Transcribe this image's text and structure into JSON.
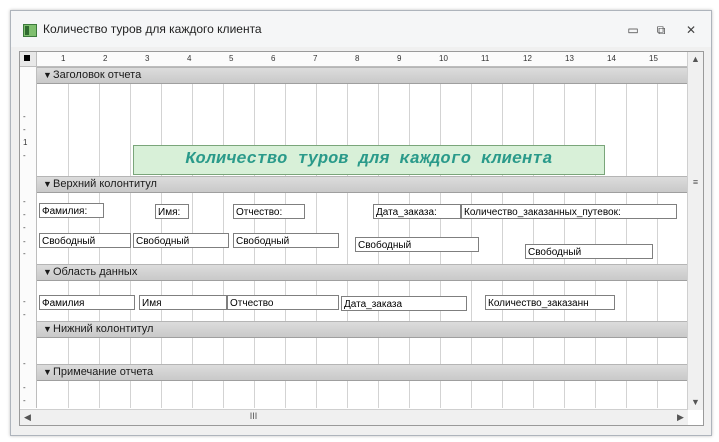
{
  "window": {
    "title": "Количество туров для каждого клиента"
  },
  "ruler": {
    "ticks": [
      "1",
      "2",
      "3",
      "4",
      "5",
      "6",
      "7",
      "8",
      "9",
      "10",
      "11",
      "12",
      "13",
      "14",
      "15"
    ]
  },
  "vruler": {
    "labels": [
      "1"
    ]
  },
  "sections": {
    "report_header": {
      "label": "Заголовок отчета"
    },
    "page_header": {
      "label": "Верхний колонтитул"
    },
    "detail": {
      "label": "Область данных"
    },
    "page_footer": {
      "label": "Нижний колонтитул"
    },
    "report_footer": {
      "label": "Примечание отчета"
    }
  },
  "report_title": "Количество туров для каждого клиента",
  "page_header_labels": {
    "lastname": "Фамилия:",
    "firstname": "Имя:",
    "middlename": "Отчество:",
    "order_date": "Дата_заказа:",
    "count": "Количество_заказанных_путевок:"
  },
  "page_header_unbound": [
    "Свободный",
    "Свободный",
    "Свободный",
    "Свободный",
    "Свободный"
  ],
  "detail_fields": {
    "lastname": "Фамилия",
    "firstname": "Имя",
    "middlename": "Отчество",
    "order_date": "Дата_заказа",
    "count": "Количество_заказанн"
  },
  "scroll": {
    "h_thumb": "III"
  }
}
